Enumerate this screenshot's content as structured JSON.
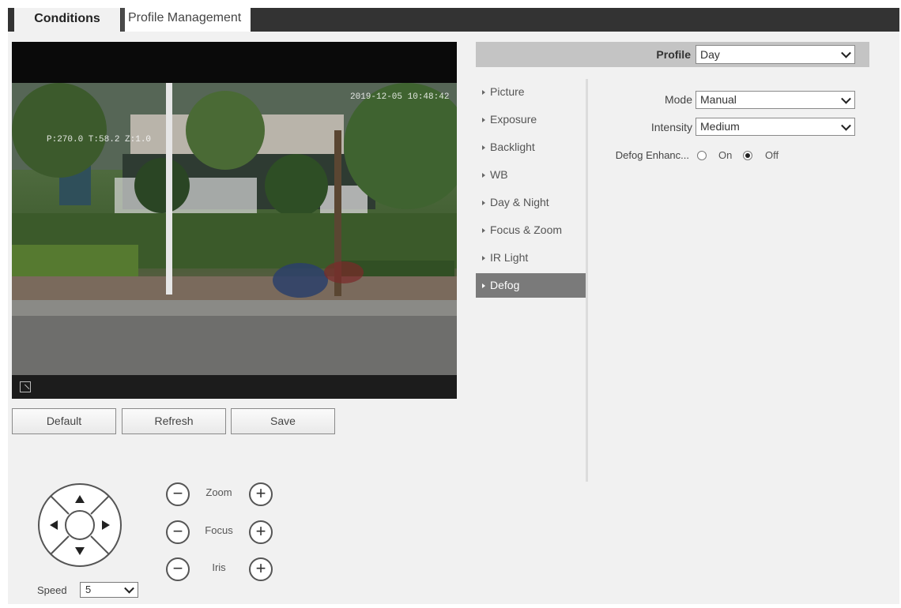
{
  "tabs": {
    "conditions": "Conditions",
    "profile_management": "Profile Management"
  },
  "video": {
    "timestamp": "2019-12-05 10:48:42",
    "ptz_position": "P:270.0 T:58.2 Z:1.0"
  },
  "buttons": {
    "default": "Default",
    "refresh": "Refresh",
    "save": "Save"
  },
  "ptz_controls": {
    "zoom_label": "Zoom",
    "focus_label": "Focus",
    "iris_label": "Iris",
    "minus": "−",
    "plus": "+",
    "speed_label": "Speed",
    "speed_value": "5"
  },
  "profile": {
    "label": "Profile",
    "value": "Day"
  },
  "menu": [
    {
      "label": "Picture",
      "active": false
    },
    {
      "label": "Exposure",
      "active": false
    },
    {
      "label": "Backlight",
      "active": false
    },
    {
      "label": "WB",
      "active": false
    },
    {
      "label": "Day & Night",
      "active": false
    },
    {
      "label": "Focus & Zoom",
      "active": false
    },
    {
      "label": "IR Light",
      "active": false
    },
    {
      "label": "Defog",
      "active": true
    }
  ],
  "defog": {
    "mode_label": "Mode",
    "mode_value": "Manual",
    "intensity_label": "Intensity",
    "intensity_value": "Medium",
    "enhance_label": "Defog Enhanc...",
    "on_label": "On",
    "off_label": "Off",
    "enhance_selected": "Off"
  }
}
